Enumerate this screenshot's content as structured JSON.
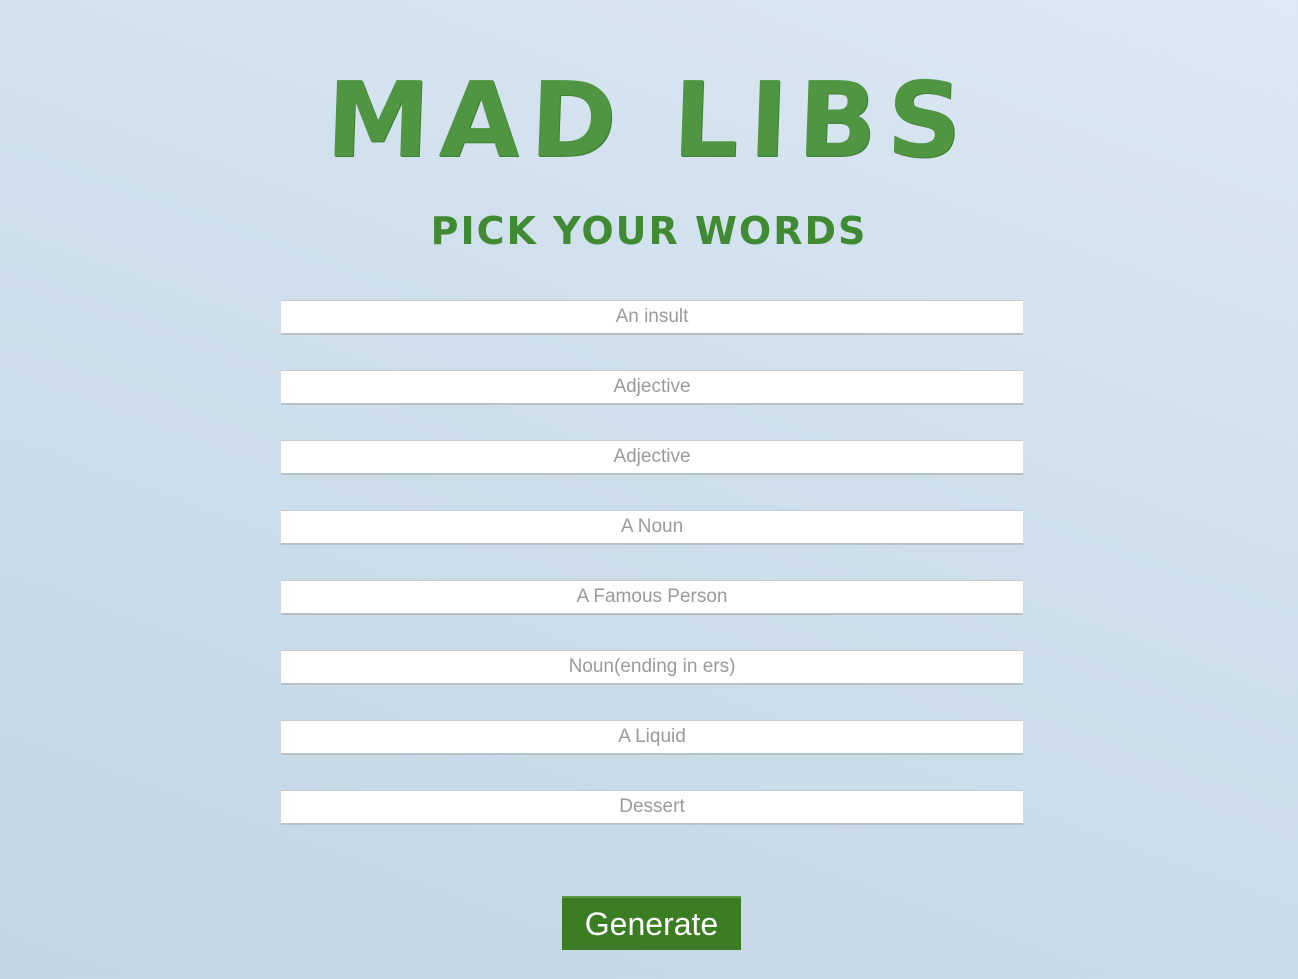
{
  "header": {
    "title": "MAD LIBS",
    "subtitle": "Pick your words"
  },
  "form": {
    "fields": [
      {
        "placeholder": "An insult",
        "value": ""
      },
      {
        "placeholder": "Adjective",
        "value": ""
      },
      {
        "placeholder": "Adjective",
        "value": ""
      },
      {
        "placeholder": "A Noun",
        "value": ""
      },
      {
        "placeholder": "A Famous Person",
        "value": ""
      },
      {
        "placeholder": "Noun(ending in ers)",
        "value": ""
      },
      {
        "placeholder": "A Liquid",
        "value": ""
      },
      {
        "placeholder": "Dessert",
        "value": ""
      }
    ],
    "submit_label": "Generate"
  },
  "colors": {
    "title_green": "#4f9542",
    "button_green": "#3b7d23",
    "background": "#cfdfec"
  }
}
